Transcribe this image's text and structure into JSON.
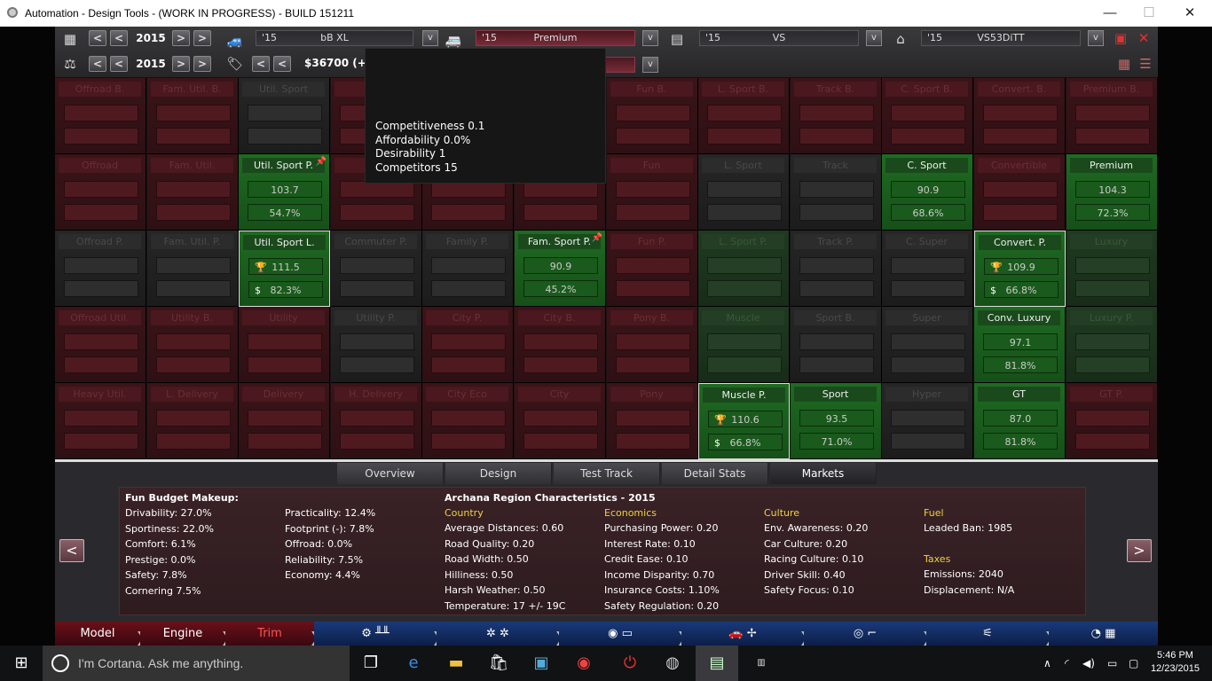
{
  "window": {
    "title": "Automation - Design Tools - (WORK IN PROGRESS) - BUILD 151211",
    "minimize": "—",
    "maximize": "☐",
    "close": "✕"
  },
  "toolbar": {
    "row1": {
      "year": "2015",
      "prev": "<",
      "prev2": "<",
      "next": ">",
      "next2": ">"
    },
    "row2": {
      "year": "2015",
      "prev": "<",
      "prev2": "<",
      "next": ">",
      "next2": ">"
    },
    "selectors": [
      {
        "year": "'15",
        "name": "bB XL"
      },
      {
        "year": "'15",
        "name": "Premium"
      },
      {
        "year": "'15",
        "name": "VS"
      },
      {
        "year": "'15",
        "name": "VS53DiTT"
      }
    ],
    "price": "$36700 (+",
    "dropdown_arrow": "v"
  },
  "tooltip": {
    "competitiveness": "Competitiveness 0.1",
    "affordability": "Affordability 0.0%",
    "desirability": "Desirability 1",
    "competitors": "Competitors 15"
  },
  "markets": [
    [
      {
        "name": "Offroad B.",
        "style": "red"
      },
      {
        "name": "Fam. Util. B.",
        "style": "red"
      },
      {
        "name": "Util. Sport",
        "style": "dark"
      },
      {
        "name": "Com",
        "style": "red"
      },
      {
        "name": "",
        "style": "red"
      },
      {
        "name": "",
        "style": "red"
      },
      {
        "name": "Fun B.",
        "style": "red"
      },
      {
        "name": "L. Sport B.",
        "style": "red"
      },
      {
        "name": "Track B.",
        "style": "red"
      },
      {
        "name": "C. Sport B.",
        "style": "red"
      },
      {
        "name": "Convert. B.",
        "style": "red"
      },
      {
        "name": "Premium B.",
        "style": "red"
      }
    ],
    [
      {
        "name": "Offroad",
        "style": "red"
      },
      {
        "name": "Fam. Util.",
        "style": "red"
      },
      {
        "name": "Util. Sport P.",
        "style": "green",
        "v1": "103.7",
        "v2": "54.7%",
        "pin": true
      },
      {
        "name": "",
        "style": "red"
      },
      {
        "name": "",
        "style": "red"
      },
      {
        "name": "",
        "style": "red"
      },
      {
        "name": "Fun",
        "style": "red"
      },
      {
        "name": "L. Sport",
        "style": "dark"
      },
      {
        "name": "Track",
        "style": "dark"
      },
      {
        "name": "C. Sport",
        "style": "green",
        "v1": "90.9",
        "v2": "68.6%"
      },
      {
        "name": "Convertible",
        "style": "red"
      },
      {
        "name": "Premium",
        "style": "green",
        "v1": "104.3",
        "v2": "72.3%"
      }
    ],
    [
      {
        "name": "Offroad P.",
        "style": "dark"
      },
      {
        "name": "Fam. Util. P.",
        "style": "dark"
      },
      {
        "name": "Util. Sport L.",
        "style": "green",
        "v1": "111.5",
        "v2": "82.3%",
        "icons": true,
        "selected": true
      },
      {
        "name": "Commuter P.",
        "style": "dark"
      },
      {
        "name": "Family P.",
        "style": "dark"
      },
      {
        "name": "Fam. Sport P.",
        "style": "green",
        "v1": "90.9",
        "v2": "45.2%",
        "pin": true
      },
      {
        "name": "Fun P.",
        "style": "red"
      },
      {
        "name": "L. Sport P.",
        "style": "dgreen"
      },
      {
        "name": "Track P.",
        "style": "dark"
      },
      {
        "name": "C. Super",
        "style": "dark"
      },
      {
        "name": "Convert. P.",
        "style": "green",
        "v1": "109.9",
        "v2": "66.8%",
        "icons": true,
        "selected": true
      },
      {
        "name": "Luxury",
        "style": "dgreen"
      }
    ],
    [
      {
        "name": "Offroad Util.",
        "style": "red"
      },
      {
        "name": "Utility B.",
        "style": "red"
      },
      {
        "name": "Utility",
        "style": "red"
      },
      {
        "name": "Utility P.",
        "style": "dark"
      },
      {
        "name": "City P.",
        "style": "red"
      },
      {
        "name": "City B.",
        "style": "red"
      },
      {
        "name": "Pony B.",
        "style": "red"
      },
      {
        "name": "Muscle",
        "style": "dgreen"
      },
      {
        "name": "Sport B.",
        "style": "dark"
      },
      {
        "name": "Super",
        "style": "dark"
      },
      {
        "name": "Conv. Luxury",
        "style": "green",
        "v1": "97.1",
        "v2": "81.8%"
      },
      {
        "name": "Luxury P.",
        "style": "dgreen"
      }
    ],
    [
      {
        "name": "Heavy Util.",
        "style": "red"
      },
      {
        "name": "L. Delivery",
        "style": "red"
      },
      {
        "name": "Delivery",
        "style": "red"
      },
      {
        "name": "H. Delivery",
        "style": "red"
      },
      {
        "name": "City Eco",
        "style": "red"
      },
      {
        "name": "City",
        "style": "red"
      },
      {
        "name": "Pony",
        "style": "red"
      },
      {
        "name": "Muscle P.",
        "style": "green",
        "v1": "110.6",
        "v2": "66.8%",
        "icons": true,
        "selected": true
      },
      {
        "name": "Sport",
        "style": "green",
        "v1": "93.5",
        "v2": "71.0%"
      },
      {
        "name": "Hyper",
        "style": "dark"
      },
      {
        "name": "GT",
        "style": "green",
        "v1": "87.0",
        "v2": "81.8%"
      },
      {
        "name": "GT P.",
        "style": "red"
      }
    ]
  ],
  "tabs": [
    "Overview",
    "Design",
    "Test Track",
    "Detail Stats",
    "Markets"
  ],
  "panel": {
    "fun_title": "Fun Budget Makeup:",
    "fun_col1": [
      "Drivability: 27.0%",
      "Sportiness: 22.0%",
      "Comfort: 6.1%",
      "Prestige: 0.0%",
      "Safety: 7.8%",
      "Cornering 7.5%"
    ],
    "fun_col2": [
      "Practicality: 12.4%",
      "Footprint (-): 7.8%",
      "Offroad: 0.0%",
      "Reliability: 7.5%",
      "Economy: 4.4%"
    ],
    "region_title": "Archana Region Characteristics - 2015",
    "country_h": "Country",
    "country": [
      "Average Distances: 0.60",
      "Road Quality: 0.20",
      "Road Width: 0.50",
      "Hilliness: 0.50",
      "Harsh Weather: 0.50",
      "Temperature: 17 +/- 19C"
    ],
    "economics_h": "Economics",
    "economics": [
      "Purchasing Power: 0.20",
      "Interest Rate: 0.10",
      "Credit Ease: 0.10",
      "Income Disparity: 0.70",
      "Insurance Costs: 1.10%",
      "Safety Regulation: 0.20"
    ],
    "culture_h": "Culture",
    "culture": [
      "Env. Awareness: 0.20",
      "Car Culture: 0.20",
      "Racing Culture: 0.10",
      "Driver Skill: 0.40",
      "Safety Focus: 0.10"
    ],
    "fuel_h": "Fuel",
    "fuel": [
      "Leaded Ban: 1985"
    ],
    "taxes_h": "Taxes",
    "taxes": [
      "Emissions: 2040",
      "Displacement: N/A"
    ],
    "left_arrow": "<",
    "right_arrow": ">"
  },
  "bottom_nav": [
    "Model",
    "Engine",
    "Trim"
  ],
  "taskbar": {
    "cortana": "I'm Cortana. Ask me anything.",
    "time": "5:46 PM",
    "date": "12/23/2015"
  }
}
